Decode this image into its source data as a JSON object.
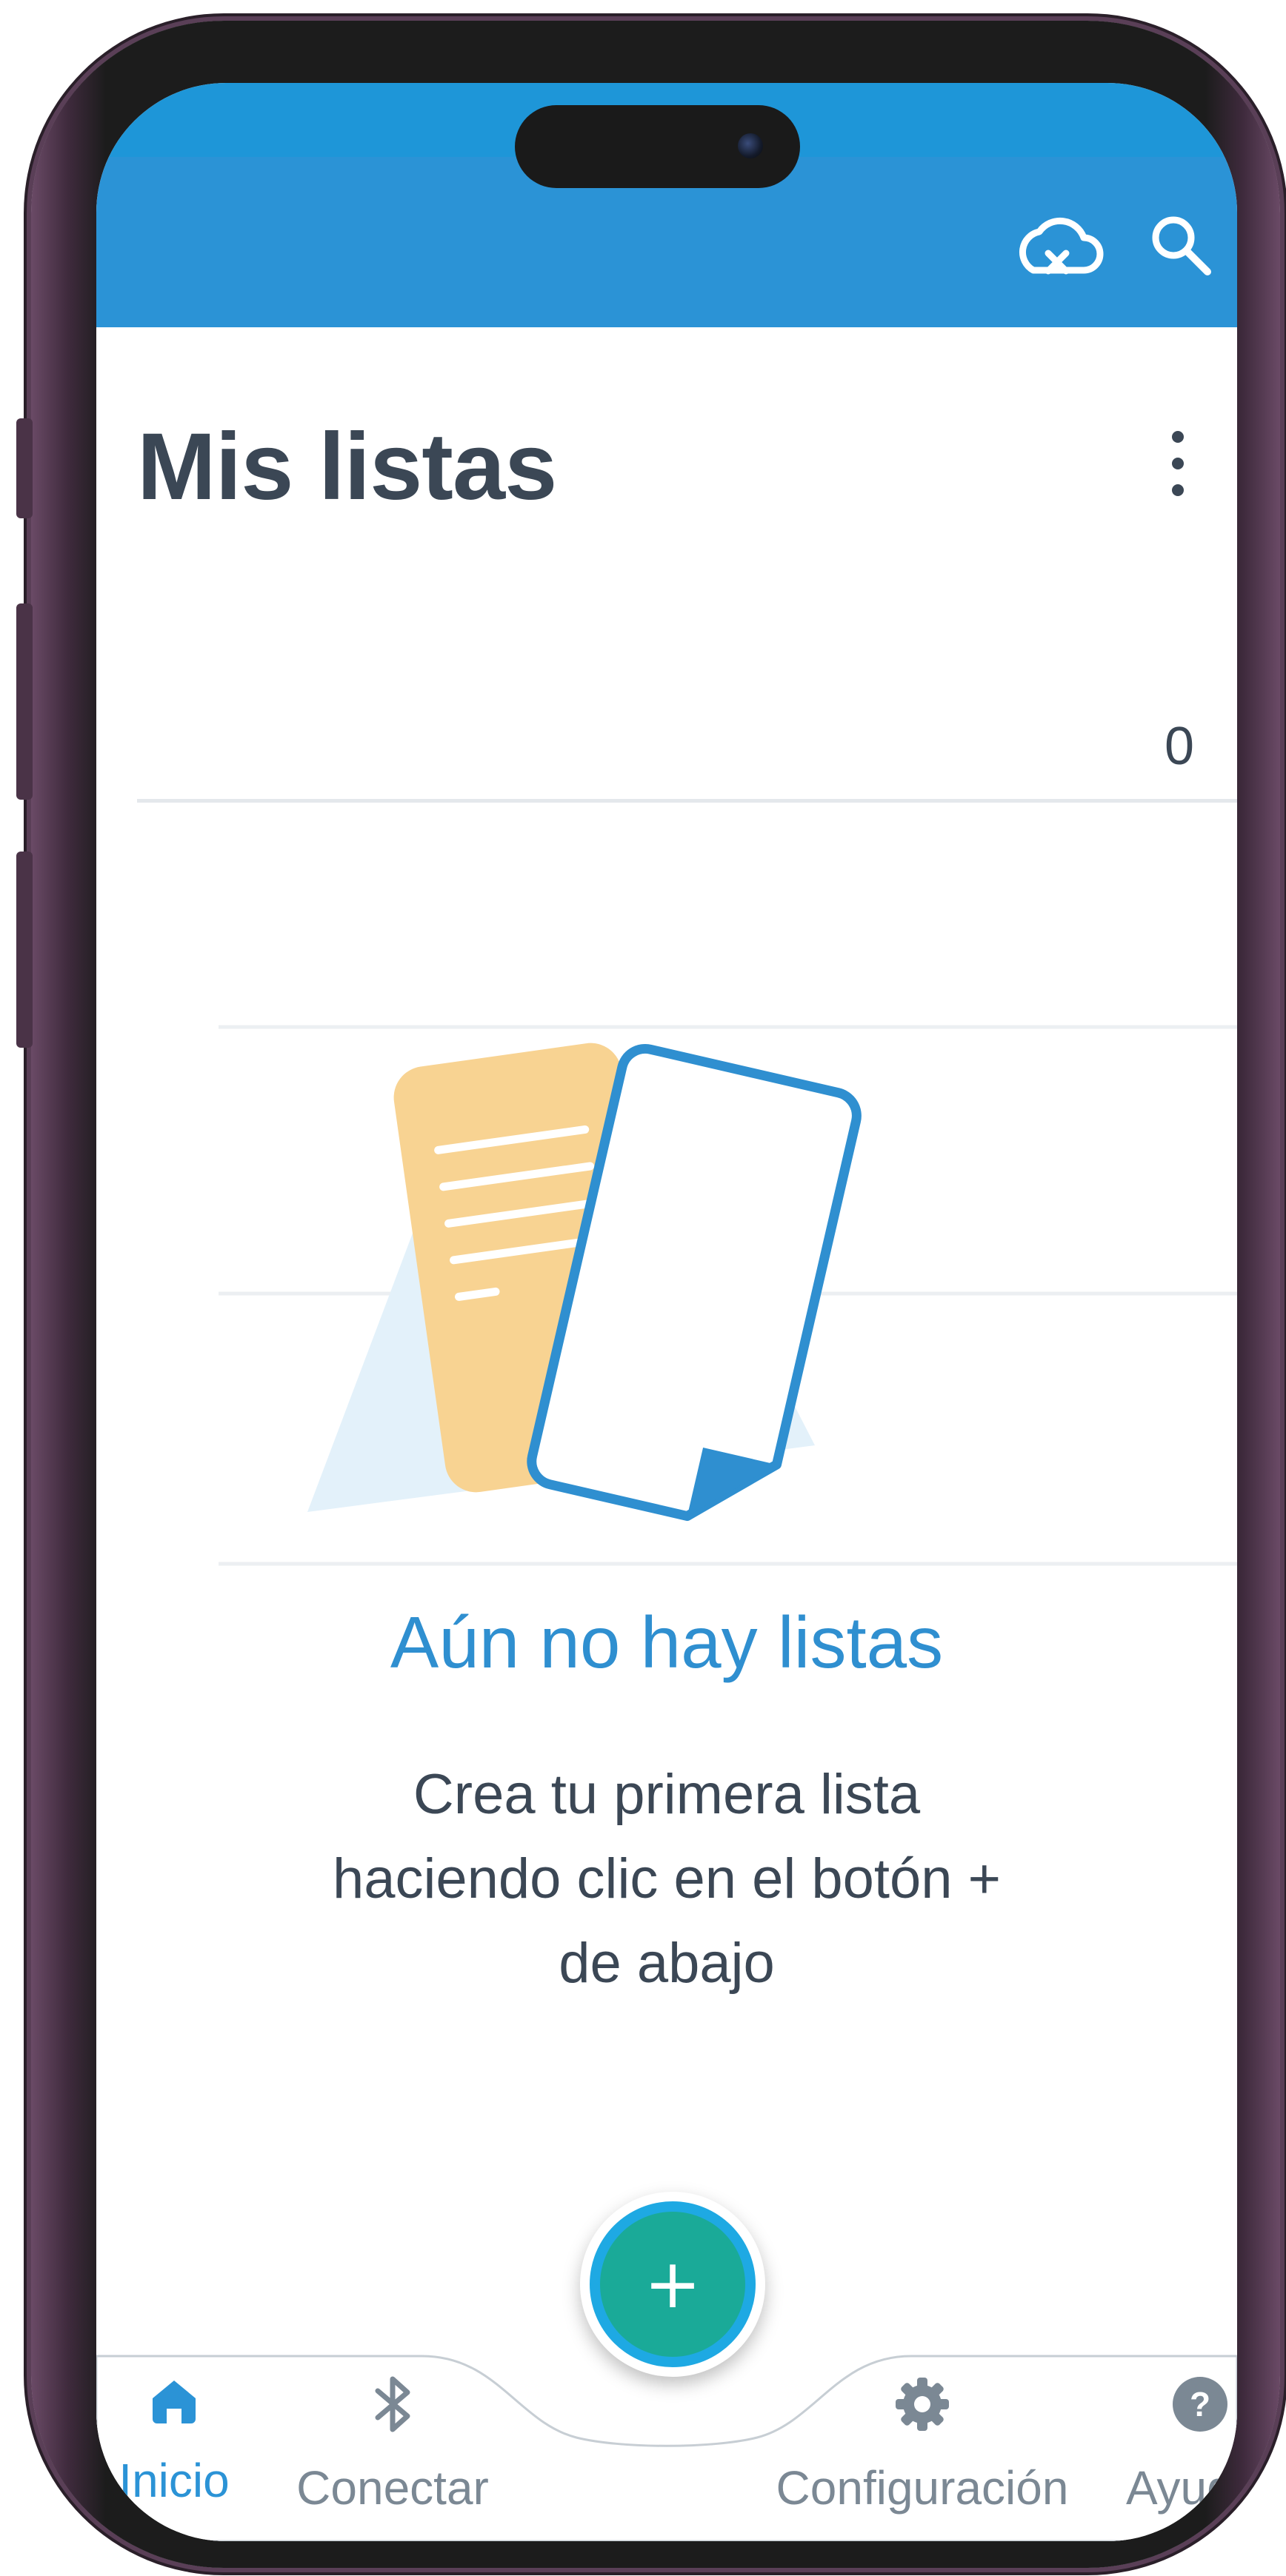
{
  "header": {
    "sync_icon": "cloud-off-icon",
    "search_icon": "search-icon",
    "title": "Mis listas",
    "menu_icon": "more-vert-icon",
    "count": "0"
  },
  "empty_state": {
    "illustration_icon": "empty-lists-illustration",
    "title": "Aún no hay listas",
    "description": "Crea tu primera lista haciendo clic en el botón + de abajo"
  },
  "fab": {
    "label": "+",
    "icon": "add-icon"
  },
  "bottom_nav": {
    "items": [
      {
        "label": "Inicio",
        "icon": "home-icon",
        "active": true
      },
      {
        "label": "Conectar",
        "icon": "bluetooth-icon",
        "active": false
      },
      {
        "label": "Configuración",
        "icon": "settings-icon",
        "active": false
      },
      {
        "label": "Ayud",
        "icon": "help-icon",
        "active": false
      }
    ]
  },
  "colors": {
    "appbar": "#2b93d6",
    "accent": "#2f8fd0",
    "fab": "#1aaa98",
    "text": "#3b4755",
    "inactive": "#7b8894"
  }
}
